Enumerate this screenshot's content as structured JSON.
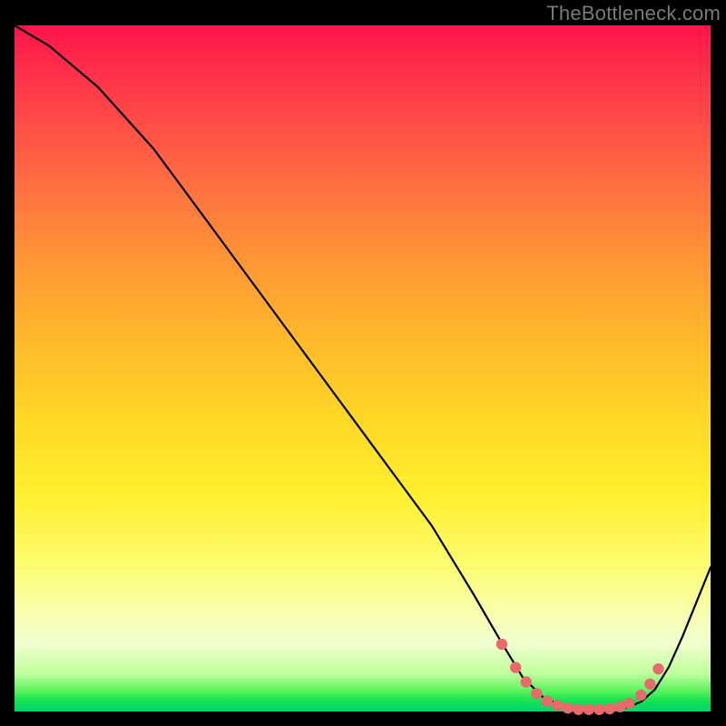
{
  "watermark": "TheBottleneck.com",
  "chart_data": {
    "type": "line",
    "title": "",
    "xlabel": "",
    "ylabel": "",
    "xlim": [
      0,
      100
    ],
    "ylim": [
      0,
      100
    ],
    "grid": false,
    "series": [
      {
        "name": "bottleneck-curve",
        "x": [
          0,
          5,
          12,
          20,
          28,
          36,
          44,
          52,
          60,
          66,
          70,
          73,
          76,
          79,
          82,
          85,
          88,
          90,
          92,
          94,
          96,
          100
        ],
        "y": [
          100,
          97,
          91,
          82,
          71,
          60,
          49,
          38,
          27,
          17,
          10,
          5,
          2,
          0.7,
          0.2,
          0.2,
          0.6,
          1.4,
          3.2,
          6.5,
          11,
          21
        ]
      }
    ],
    "markers": {
      "name": "highlight-dots",
      "color": "#E86A6B",
      "x": [
        70,
        72,
        73.5,
        75,
        76.5,
        78,
        79.5,
        81,
        82.5,
        84,
        85.5,
        87,
        88.3,
        90,
        91.3,
        92.5
      ],
      "y": [
        9.8,
        6.4,
        4.3,
        2.6,
        1.5,
        0.9,
        0.5,
        0.3,
        0.3,
        0.3,
        0.4,
        0.7,
        1.2,
        2.4,
        4.0,
        6.2
      ]
    },
    "background_gradient": {
      "top": "#FF144B",
      "upper_mid": "#FFD926",
      "lower_mid": "#F8FFA8",
      "bottom": "#02D36F"
    }
  }
}
